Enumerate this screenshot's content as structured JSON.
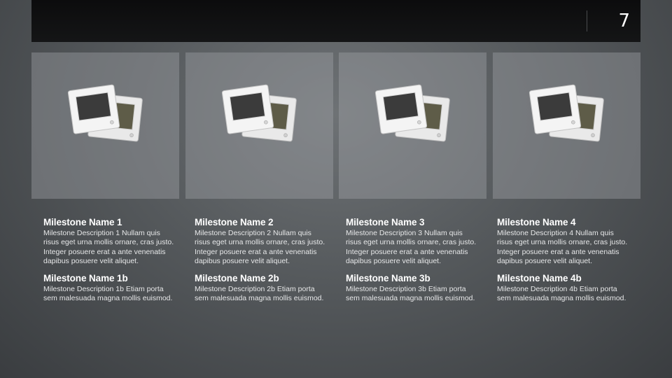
{
  "page": {
    "number": "7"
  },
  "milestones": [
    {
      "name1": "Milestone Name 1",
      "desc1": "Milestone Description 1 Nullam quis risus eget urna mollis ornare, cras justo. Integer posuere erat a ante venenatis dapibus posuere velit aliquet.",
      "name2": "Milestone Name 1b",
      "desc2": "Milestone Description 1b Etiam porta sem malesuada magna mollis euismod.",
      "icon": "photo-slides-icon"
    },
    {
      "name1": "Milestone Name 2",
      "desc1": "Milestone Description 2 Nullam quis risus eget urna mollis ornare, cras justo. Integer posuere erat a ante venenatis dapibus posuere velit aliquet.",
      "name2": "Milestone Name 2b",
      "desc2": "Milestone Description 2b Etiam porta sem malesuada magna mollis euismod.",
      "icon": "photo-slides-icon"
    },
    {
      "name1": "Milestone Name 3",
      "desc1": "Milestone Description 3 Nullam quis risus eget urna mollis ornare, cras justo. Integer posuere erat a ante venenatis dapibus posuere velit aliquet.",
      "name2": "Milestone Name 3b",
      "desc2": "Milestone Description 3b Etiam porta sem malesuada magna mollis euismod.",
      "icon": "photo-slides-icon"
    },
    {
      "name1": "Milestone Name 4",
      "desc1": "Milestone Description 4 Nullam quis risus eget urna mollis ornare, cras justo. Integer posuere erat a ante venenatis dapibus posuere velit aliquet.",
      "name2": "Milestone Name 4b",
      "desc2": "Milestone Description 4b Etiam porta sem malesuada magna mollis euismod.",
      "icon": "photo-slides-icon"
    }
  ]
}
